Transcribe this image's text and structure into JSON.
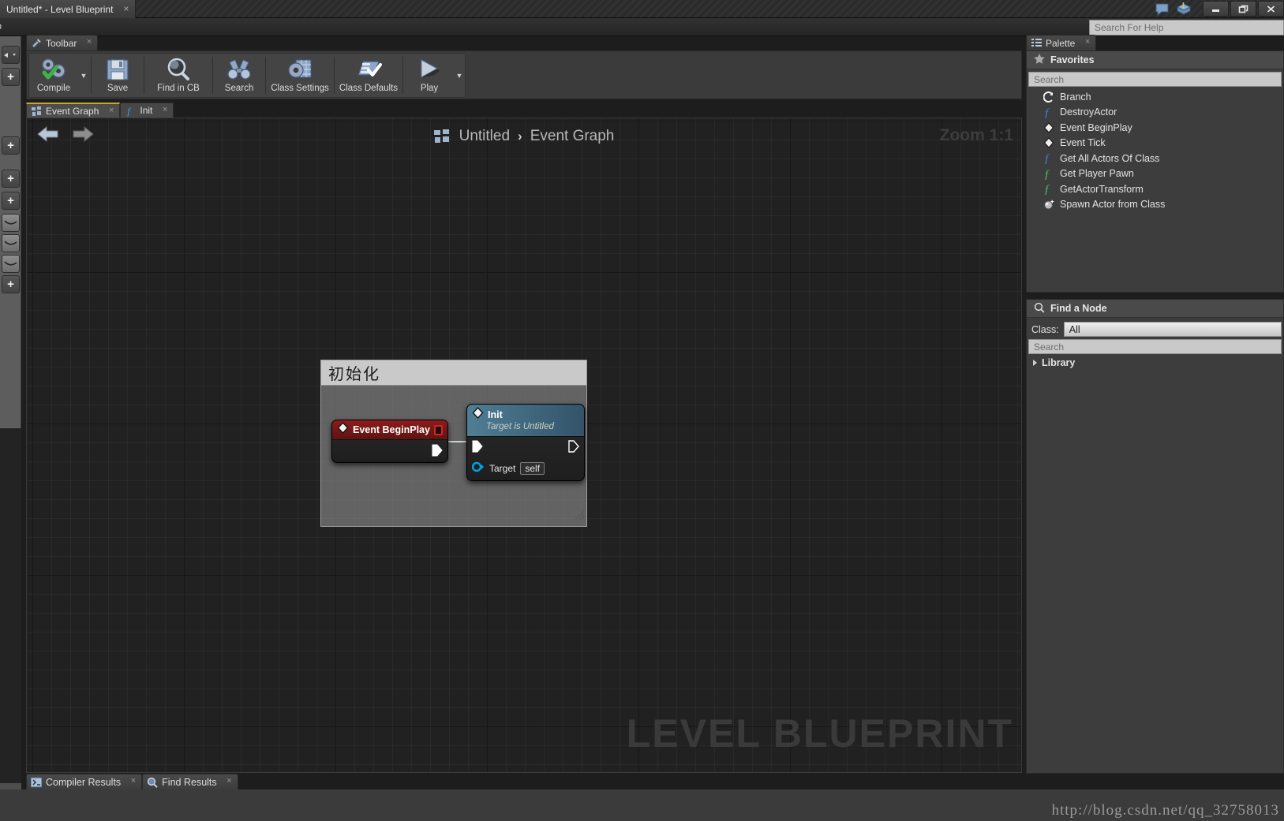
{
  "window": {
    "title": "Untitled* - Level Blueprint",
    "close_glyph": "×",
    "icons": [
      "feedback-icon",
      "documentation-icon"
    ],
    "controls": {
      "minimize": "–",
      "restore": "❐",
      "close": "×"
    }
  },
  "menubar": {
    "help_label": "elp",
    "help_search_placeholder": "Search For Help"
  },
  "toolbar_panel": {
    "tab_label": "Toolbar",
    "tab_close": "×",
    "items": [
      {
        "label": "Compile",
        "icon": "compile-icon",
        "has_caret": true
      },
      {
        "label": "Save",
        "icon": "save-icon",
        "has_caret": false
      },
      {
        "label": "Find in CB",
        "icon": "find-in-cb-icon",
        "has_caret": false
      },
      {
        "label": "Search",
        "icon": "search-binoculars-icon",
        "has_caret": false
      },
      {
        "label": "Class Settings",
        "icon": "class-settings-icon",
        "has_caret": false
      },
      {
        "label": "Class Defaults",
        "icon": "class-defaults-icon",
        "has_caret": false
      },
      {
        "label": "Play",
        "icon": "play-icon",
        "has_caret": true
      }
    ]
  },
  "graph_tabs": [
    {
      "label": "Event Graph",
      "icon": "event-graph-icon",
      "active": true,
      "close": "×"
    },
    {
      "label": "Init",
      "icon": "function-icon",
      "active": false,
      "close": "×"
    }
  ],
  "graph": {
    "breadcrumb": {
      "icon": "blueprint-icon",
      "root": "Untitled",
      "separator": "›",
      "current": "Event Graph"
    },
    "zoom_label": "Zoom 1:1",
    "watermark": "LEVEL BLUEPRINT",
    "back_arrow": "back-arrow-icon",
    "forward_arrow": "forward-arrow-icon",
    "comment": {
      "title": "初始化"
    },
    "nodes": [
      {
        "name": "Event BeginPlay",
        "type": "event",
        "exec_out": "▶"
      },
      {
        "name": "Init",
        "type": "function-call",
        "subtitle": "Target is Untitled",
        "exec_in": "▶",
        "exec_out": "▷",
        "pins": [
          {
            "label": "Target",
            "value": "self"
          }
        ]
      }
    ]
  },
  "palette": {
    "tab_label": "Palette",
    "tab_close": "×",
    "section_title": "Favorites",
    "section_icon": "star-icon",
    "search_placeholder": "Search",
    "items": [
      {
        "label": "Branch",
        "icon": "branch-icon"
      },
      {
        "label": "DestroyActor",
        "icon": "function-blue-icon"
      },
      {
        "label": "Event BeginPlay",
        "icon": "event-diamond-icon"
      },
      {
        "label": "Event Tick",
        "icon": "event-diamond-icon"
      },
      {
        "label": "Get All Actors Of Class",
        "icon": "function-blue-icon"
      },
      {
        "label": "Get Player Pawn",
        "icon": "function-green-icon"
      },
      {
        "label": "GetActorTransform",
        "icon": "function-green-icon"
      },
      {
        "label": "Spawn Actor from Class",
        "icon": "spawn-actor-icon"
      }
    ]
  },
  "find_a_node": {
    "title": "Find a Node",
    "title_icon": "magnifier-icon",
    "class_label": "Class:",
    "class_value": "All",
    "search_placeholder": "Search",
    "library_label": "Library"
  },
  "bottom_tabs": [
    {
      "label": "Compiler Results",
      "icon": "compiler-results-icon",
      "close": "×"
    },
    {
      "label": "Find Results",
      "icon": "find-results-icon",
      "close": "×"
    }
  ],
  "url_watermark": "http://blog.csdn.net/qq_32758013",
  "colors": {
    "accent_tab": "#c8a431",
    "event_node": "#8e1b1b",
    "function_node": "#4e7e95",
    "exec_pin": "#ffffff",
    "object_pin": "#00a2e8"
  }
}
